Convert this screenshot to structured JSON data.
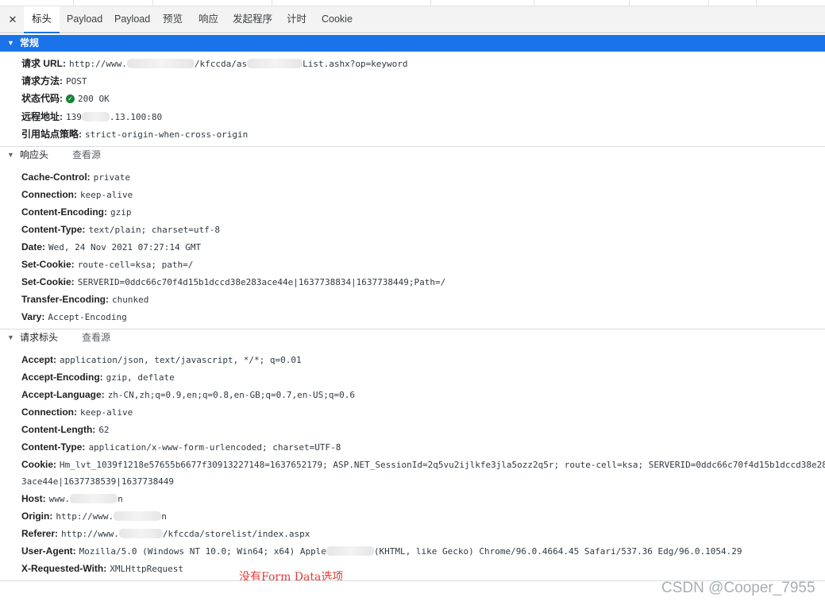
{
  "tabs": [
    "标头",
    "Payload",
    "Payload",
    "预览",
    "响应",
    "发起程序",
    "计时",
    "Cookie"
  ],
  "close_icon": "close-icon",
  "general": {
    "title": "常规",
    "rows": [
      {
        "key": "请求 URL:",
        "a": "http://www.",
        "b": "/kfccda/as",
        "c": "List.ashx?op=keyword"
      },
      {
        "key": "请求方法:",
        "value": "POST"
      },
      {
        "key": "状态代码:",
        "value": "200 OK",
        "icon": "check-circle-icon",
        "icon_color": "#188038"
      },
      {
        "key": "远程地址:",
        "a": "139",
        "b": ".13.",
        "c": "100:80"
      },
      {
        "key": "引用站点策略:",
        "value": "strict-origin-when-cross-origin"
      }
    ]
  },
  "response_headers": {
    "title": "响应头",
    "view_source": "查看源",
    "rows": [
      {
        "key": "Cache-Control:",
        "value": "private"
      },
      {
        "key": "Connection:",
        "value": "keep-alive"
      },
      {
        "key": "Content-Encoding:",
        "value": "gzip"
      },
      {
        "key": "Content-Type:",
        "value": "text/plain; charset=utf-8"
      },
      {
        "key": "Date:",
        "value": "Wed, 24 Nov 2021 07:27:14 GMT"
      },
      {
        "key": "Set-Cookie:",
        "value": "route-cell=ksa; path=/"
      },
      {
        "key": "Set-Cookie:",
        "value": "SERVERID=0ddc66c70f4d15b1dccd38e283ace44e|1637738834|1637738449;Path=/"
      },
      {
        "key": "Transfer-Encoding:",
        "value": "chunked"
      },
      {
        "key": "Vary:",
        "value": "Accept-Encoding"
      }
    ]
  },
  "request_headers": {
    "title": "请求标头",
    "view_source": "查看源",
    "rows": [
      {
        "key": "Accept:",
        "value": "application/json, text/javascript, */*; q=0.01"
      },
      {
        "key": "Accept-Encoding:",
        "value": "gzip, deflate"
      },
      {
        "key": "Accept-Language:",
        "value": "zh-CN,zh;q=0.9,en;q=0.8,en-GB;q=0.7,en-US;q=0.6"
      },
      {
        "key": "Connection:",
        "value": "keep-alive"
      },
      {
        "key": "Content-Length:",
        "value": "62"
      },
      {
        "key": "Content-Type:",
        "value": "application/x-www-form-urlencoded; charset=UTF-8"
      },
      {
        "key": "Cookie:",
        "value": "Hm_lvt_1039f1218e57655b6677f30913227148=1637652179; ASP.NET_SessionId=2q5vu2ijlkfe3jla5ozz2q5r; route-cell=ksa; SERVERID=0ddc66c70f4d15b1dccd38e28",
        "cont": "3ace44e|1637738539|1637738449"
      },
      {
        "key": "Host:",
        "a": "www.",
        "b": "",
        "c": "n"
      },
      {
        "key": "Origin:",
        "a": "http://www.",
        "b": "",
        "c": "n"
      },
      {
        "key": "Referer:",
        "a": "http://www.",
        "b": "",
        "c": "/kfccda/storelist/index.aspx"
      },
      {
        "key": "User-Agent:",
        "a": "Mozilla/5.0 (Windows NT 10.0; Win64; x64) Apple",
        "b": "",
        "c": "(KHTML, like Gecko) Chrome/96.0.4664.45 Safari/537.36 Edg/96.0.1054.29"
      },
      {
        "key": "X-Requested-With:",
        "value": "XMLHttpRequest"
      }
    ]
  },
  "annotation": "没有Form Data选项",
  "watermark": "CSDN @Cooper_7955"
}
